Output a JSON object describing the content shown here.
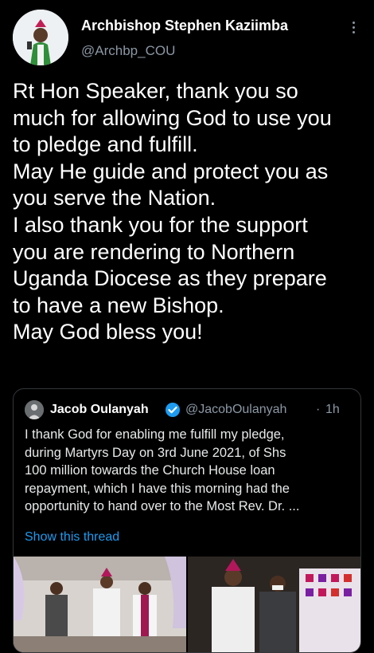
{
  "author": {
    "name": "Archbishop Stephen Kaziimba",
    "handle": "@Archbp_COU"
  },
  "tweet": {
    "text": "Rt Hon Speaker, thank you so\nmuch for allowing God to use you\nto pledge and fulfill.\nMay He guide and protect you as\nyou serve the Nation.\nI also thank you for the support\nyou are rendering to Northern\nUganda Diocese as they prepare\nto have a new Bishop.\nMay God bless you!"
  },
  "quoted": {
    "name": "Jacob Oulanyah",
    "handle": "@JacobOulanyah",
    "separator": "·",
    "time": "1h",
    "text": "I thank God for enabling me fulfill my pledge,\nduring Martyrs Day on 3rd June 2021, of Shs\n100 million towards the Church House loan\nrepayment, which I have this morning had the\nopportunity to hand over to the Most Rev. Dr. ...",
    "show_thread": "Show this thread"
  },
  "icons": {
    "more": "more-vertical-icon",
    "verified": "verified-badge-icon"
  },
  "colors": {
    "background": "#000000",
    "text": "#ffffff",
    "secondary": "#8b98a5",
    "link": "#1d9bf0",
    "verified": "#1d9bf0"
  }
}
